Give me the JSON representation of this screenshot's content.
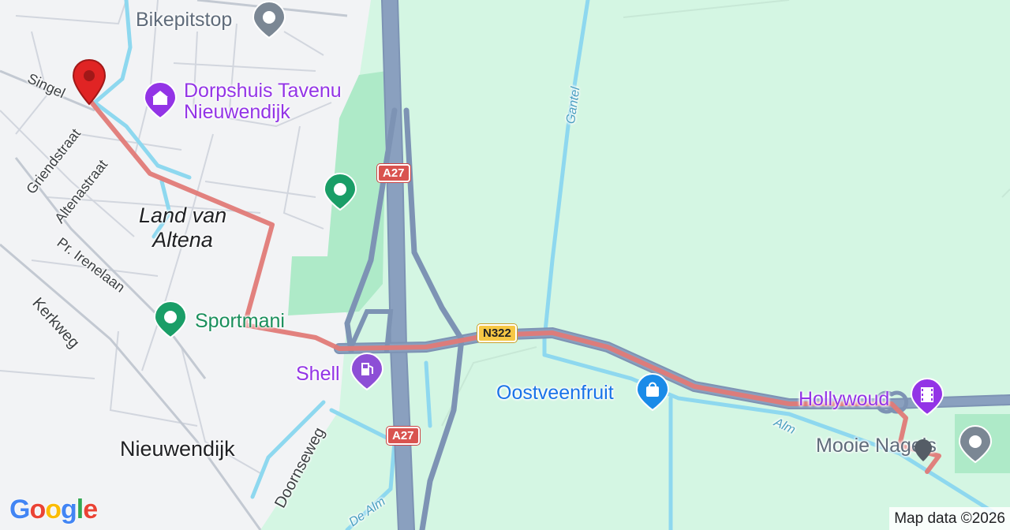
{
  "map": {
    "places": {
      "land_van_altena": "Land van\nAltena",
      "nieuwendijk": "Nieuwendijk"
    },
    "streets": {
      "singel": "Singel",
      "griendstraat": "Griendstraat",
      "altenastraat": "Altenastraat",
      "irenelaan": "Pr. Irenelaan",
      "kerkweg": "Kerkweg",
      "doornseweg": "Doornseweg"
    },
    "water": {
      "gantel": "Gantel",
      "alm": "Alm",
      "de_alm": "De Alm"
    },
    "road_shields": {
      "a27_top": "A27",
      "a27_bottom": "A27",
      "n322": "N322"
    },
    "pois": {
      "bikepitstop": "Bikepitstop",
      "dorpshuis": "Dorpshuis Tavenu\nNieuwendijk",
      "sportmani": "Sportmani",
      "shell": "Shell",
      "oostveenfruit": "Oostveenfruit",
      "hollywoud": "Hollywoud",
      "mooie_nagels": "Mooie Nagels"
    },
    "icons": {
      "destination_pin": "red-map-pin-icon",
      "end_marker": "grey-map-pin-icon",
      "poi_generic": "location-dot-icon",
      "poi_museum": "landmark-icon",
      "poi_fuel": "fuel-pump-icon",
      "poi_shop": "shopping-bag-icon",
      "poi_cinema": "film-icon"
    },
    "colors": {
      "route": "#e07a77",
      "highway": "#8aa0bf",
      "water": "#8ed8ef",
      "park": "#aeeac8",
      "land": "#d4f6e3",
      "urban": "#f2f3f5"
    },
    "logo": "Google",
    "attribution": "Map data ©2026"
  }
}
